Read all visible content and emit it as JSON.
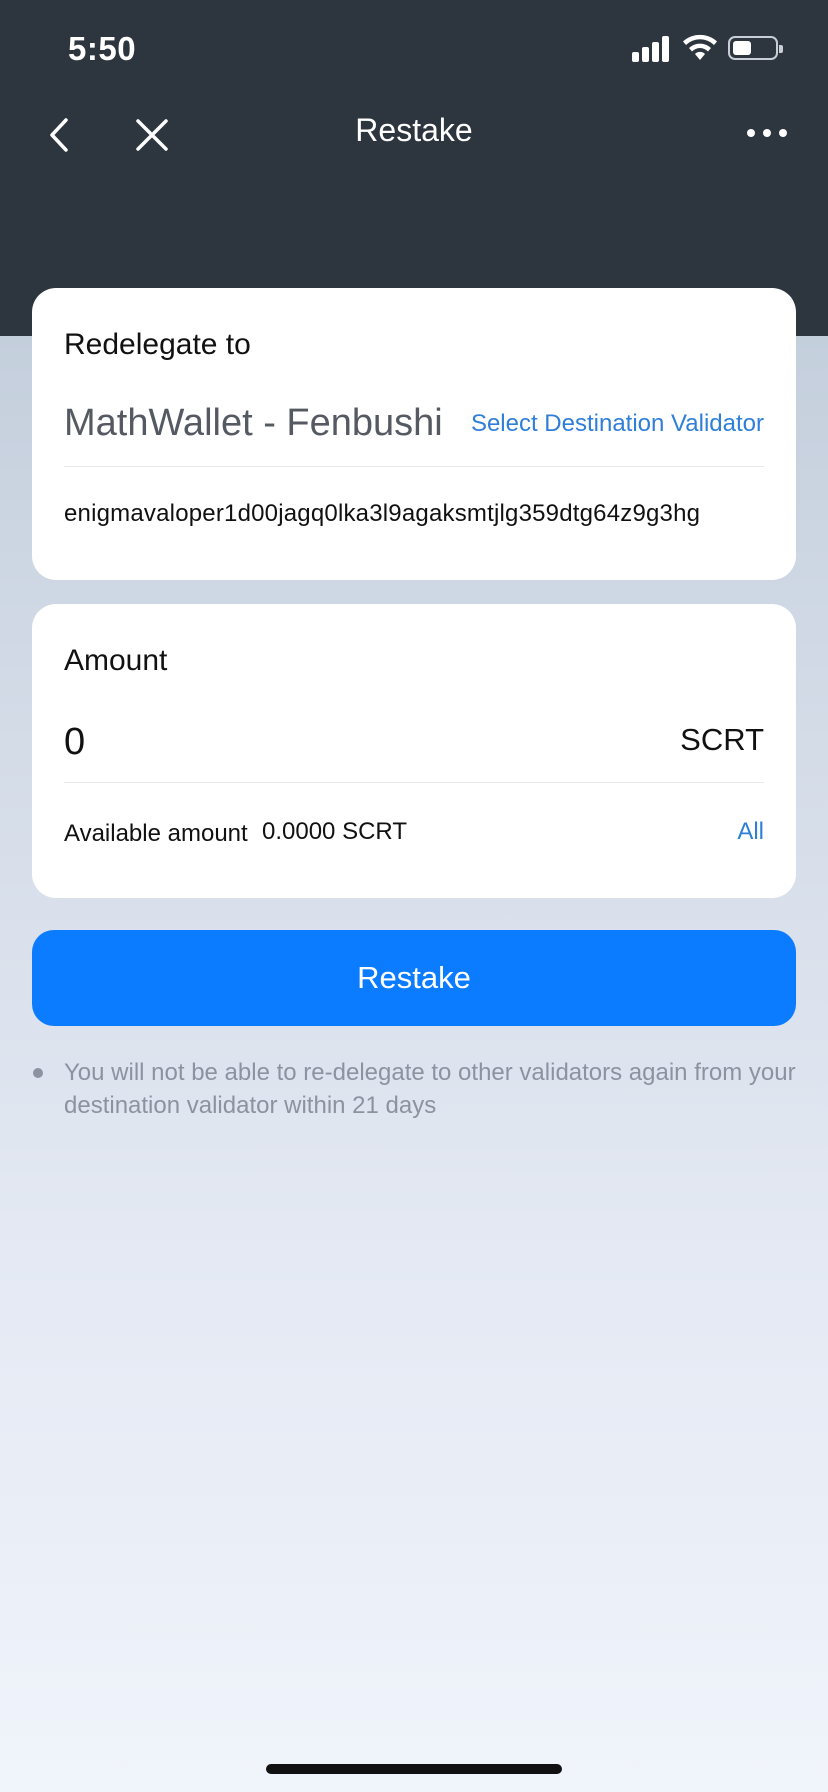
{
  "status_bar": {
    "time": "5:50"
  },
  "nav": {
    "title": "Restake"
  },
  "redelegate": {
    "label": "Redelegate to",
    "validator_name": "MathWallet - Fenbushi",
    "select_label": "Select Destination Validator",
    "validator_address": "enigmavaloper1d00jagq0lka3l9agaksmtjlg359dtg64z9g3hg"
  },
  "amount": {
    "label": "Amount",
    "value": "0",
    "unit": "SCRT",
    "available_label": "Available amount",
    "available_value": "0.0000 SCRT",
    "all_label": "All"
  },
  "restake_button": {
    "label": "Restake"
  },
  "notice": {
    "text": "You will not be able to re-delegate to other validators again from your destination validator within 21 days"
  },
  "colors": {
    "accent": "#0b7cff",
    "link": "#2f7fd8",
    "header_bg": "#2d353e",
    "muted_text": "#8c93a0"
  }
}
